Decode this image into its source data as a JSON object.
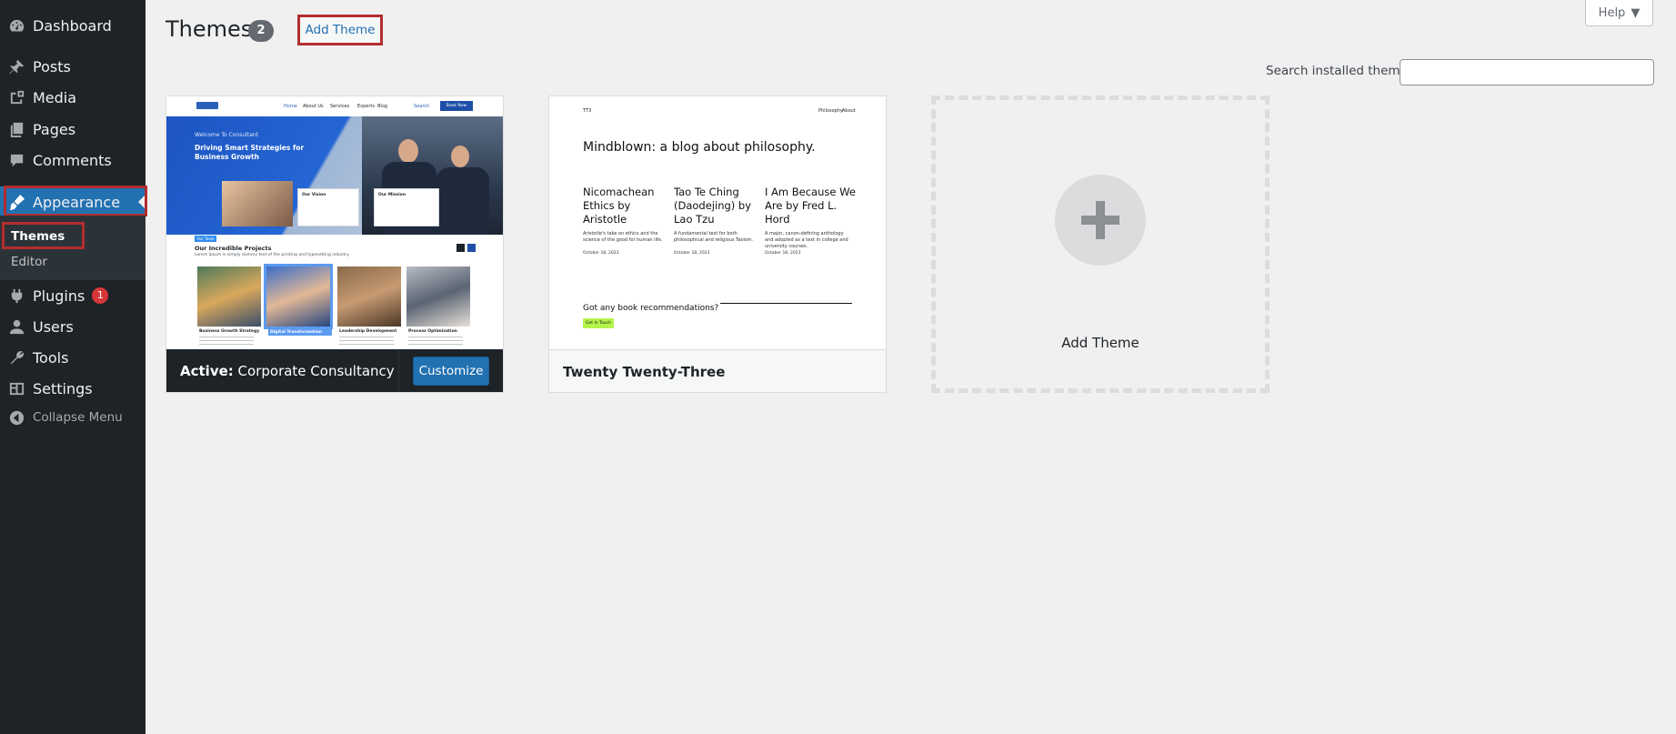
{
  "sidebar": {
    "items": [
      {
        "label": "Dashboard",
        "icon": "dashboard-icon"
      },
      {
        "label": "Posts",
        "icon": "pin-icon"
      },
      {
        "label": "Media",
        "icon": "media-icon"
      },
      {
        "label": "Pages",
        "icon": "pages-icon"
      },
      {
        "label": "Comments",
        "icon": "comment-icon"
      },
      {
        "label": "Appearance",
        "icon": "brush-icon"
      },
      {
        "label": "Plugins",
        "icon": "plugin-icon",
        "badge": "1"
      },
      {
        "label": "Users",
        "icon": "user-icon"
      },
      {
        "label": "Tools",
        "icon": "wrench-icon"
      },
      {
        "label": "Settings",
        "icon": "settings-icon"
      },
      {
        "label": "Collapse Menu",
        "icon": "collapse-icon"
      }
    ],
    "submenu": [
      {
        "label": "Themes"
      },
      {
        "label": "Editor"
      }
    ],
    "accent_color": "#2271b1",
    "highlight_color": "#b32d2e"
  },
  "header": {
    "title": "Themes",
    "count": "2",
    "add_theme_label": "Add Theme",
    "help_label": "Help"
  },
  "search": {
    "label": "Search installed themes",
    "value": "",
    "placeholder": ""
  },
  "themes": [
    {
      "active_prefix": "Active:",
      "name": "Corporate Consultancy",
      "customize_label": "Customize",
      "shot": {
        "nav": [
          "Home",
          "About Us",
          "Services",
          "Experts",
          "Blog"
        ],
        "search": "Search",
        "book": "Book Now",
        "welcome": "Welcome To Consultant",
        "hero_title": "Driving Smart Strategies for Business Growth",
        "card_titles": [
          "Our Vision",
          "Our Mission"
        ],
        "pill": "Our Team",
        "section_title": "Our Incredible Projects",
        "section_sub": "Lorem Ipsum is simply dummy text of the printing and typesetting industry.",
        "projects": [
          "Business Growth Strategy",
          "Digital Transformation",
          "Leadership Development",
          "Process Optimization"
        ]
      }
    },
    {
      "name": "Twenty Twenty-Three",
      "shot": {
        "site_tag": "TT3",
        "nav": [
          "Philosophy",
          "About"
        ],
        "heading": "Mindblown: a blog about philosophy.",
        "posts": [
          {
            "title": "Nicomachean Ethics by Aristotle",
            "desc": "Aristotle's take on ethics and the science of the good for human life.",
            "date": "October 18, 2023"
          },
          {
            "title": "Tao Te Ching (Daodejing) by Lao Tzu",
            "desc": "A fundamental text for both philosophical and religious Taoism.",
            "date": "October 18, 2023"
          },
          {
            "title": "I Am Because We Are by Fred L. Hord",
            "desc": "A major, canon-defining anthology and adopted as a text in college and university courses.",
            "date": "October 18, 2023"
          }
        ],
        "cta_question": "Got any book recommendations?",
        "cta_button": "Get In Touch"
      }
    }
  ],
  "add_new": {
    "label": "Add Theme",
    "icon": "plus-icon"
  }
}
